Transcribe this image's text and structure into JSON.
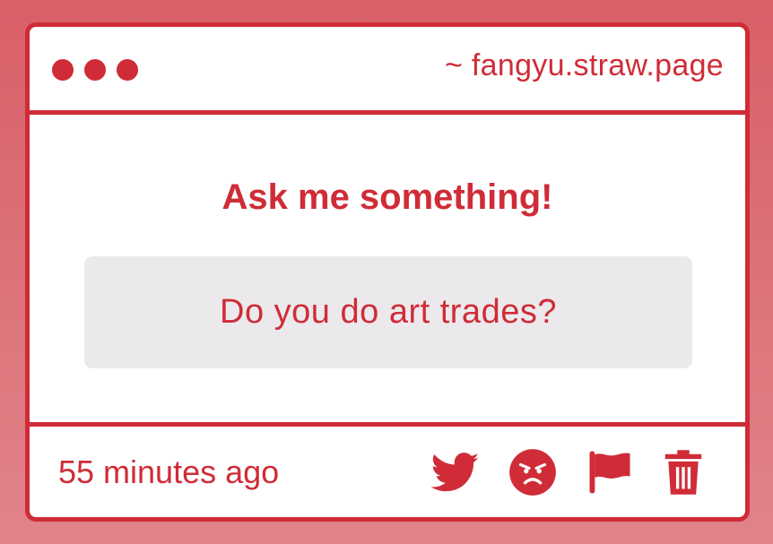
{
  "window": {
    "url": "~ fangyu.straw.page"
  },
  "main": {
    "heading": "Ask me something!",
    "question": "Do you do art trades?"
  },
  "footer": {
    "timestamp": "55 minutes ago",
    "actions": [
      "twitter-icon",
      "angry-face-icon",
      "flag-icon",
      "trash-icon"
    ]
  },
  "colors": {
    "accent": "#cf2c37",
    "background": "#d95f68",
    "question_bg": "#ebe9eb"
  }
}
